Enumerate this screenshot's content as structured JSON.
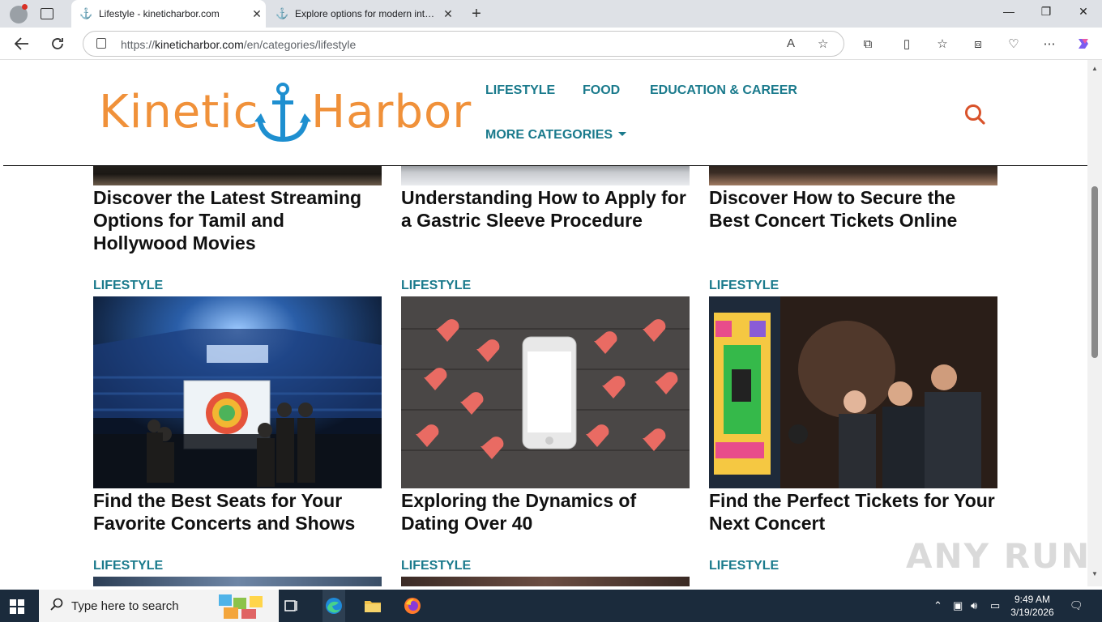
{
  "browser": {
    "tabs": [
      {
        "title": "Lifestyle - kineticharbor.com",
        "active": true
      },
      {
        "title": "Explore options for modern interior",
        "active": false
      }
    ],
    "url_prefix": "https://",
    "url_domain": "kineticharbor.com",
    "url_path": "/en/categories/lifestyle"
  },
  "site": {
    "logo_left": "Kinetic",
    "logo_right": "Harbor",
    "nav": [
      {
        "label": "LIFESTYLE"
      },
      {
        "label": "FOOD"
      },
      {
        "label": "EDUCATION & CAREER"
      },
      {
        "label": "MORE CATEGORIES"
      }
    ]
  },
  "articles": {
    "top_row": [
      {
        "title": "Discover the Latest Streaming Options for Tamil and Hollywood Movies"
      },
      {
        "title": "Understanding How to Apply for a Gastric Sleeve Procedure"
      },
      {
        "title": "Discover How to Secure the Best Concert Tickets Online"
      }
    ],
    "middle_row": [
      {
        "category": "LIFESTYLE",
        "title": "Find the Best Seats for Your Favorite Concerts and Shows"
      },
      {
        "category": "LIFESTYLE",
        "title": "Exploring the Dynamics of Dating Over 40"
      },
      {
        "category": "LIFESTYLE",
        "title": "Find the Perfect Tickets for Your Next Concert"
      }
    ],
    "bottom_row": [
      {
        "category": "LIFESTYLE"
      },
      {
        "category": "LIFESTYLE"
      },
      {
        "category": "LIFESTYLE"
      }
    ]
  },
  "watermark": "ANY RUN",
  "taskbar": {
    "search_placeholder": "Type here to search",
    "time": "9:49 AM",
    "date": "3/19/2026"
  },
  "colors": {
    "accent": "#1a7a8c",
    "logo_orange": "#f0913a",
    "logo_blue": "#1e8fd0",
    "search_red": "#d9532b"
  }
}
